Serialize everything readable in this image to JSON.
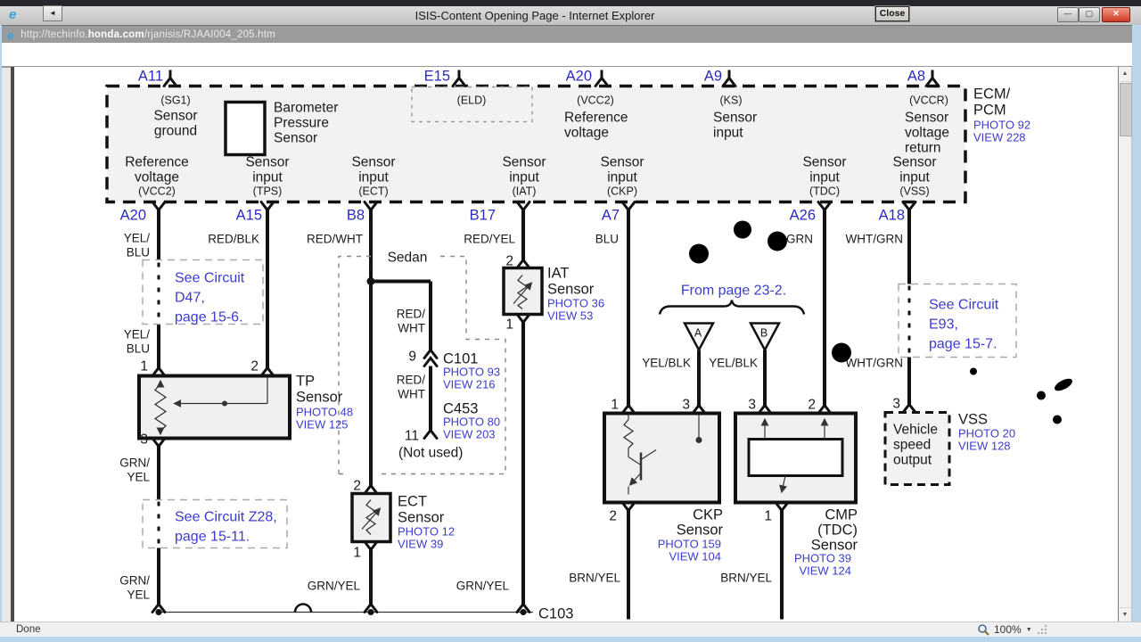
{
  "chrome": {
    "title": "ISIS-Content Opening Page - Internet Explorer",
    "logo": "e",
    "url": {
      "prefix": "http://techinfo.",
      "domain": "honda.com",
      "path": "/rjanisis/RJAAI004_205.htm"
    },
    "buttons": {
      "minimize": "—",
      "maximize": "▢",
      "close": "✕"
    },
    "back_arrow": "◄",
    "close_label": "Close",
    "scroll_up": "▲",
    "scroll_down": "▼",
    "status": "Done",
    "zoom_level": "100%",
    "zoom_caret": "▼"
  },
  "diagram": {
    "ecm": {
      "top_pins": [
        {
          "id": "A11",
          "sub": "(SG1)",
          "l1": "Sensor",
          "l2": "ground",
          "l3": ""
        },
        {
          "id": "E15",
          "sub": "(ELD)",
          "l1": "",
          "l2": "",
          "l3": ""
        },
        {
          "id": "A20",
          "sub": "(VCC2)",
          "l1": "Reference",
          "l2": "voltage",
          "l3": ""
        },
        {
          "id": "A9",
          "sub": "(KS)",
          "l1": "Sensor",
          "l2": "input",
          "l3": ""
        },
        {
          "id": "A8",
          "sub": "(VCCR)",
          "l1": "Sensor",
          "l2": "voltage",
          "l3": "return"
        }
      ],
      "baro": {
        "l1": "Barometer",
        "l2": "Pressure",
        "l3": "Sensor"
      },
      "bottom_labels": [
        {
          "l1": "Reference",
          "l2": "voltage",
          "sub": "(VCC2)"
        },
        {
          "l1": "Sensor",
          "l2": "input",
          "sub": "(TPS)"
        },
        {
          "l1": "Sensor",
          "l2": "input",
          "sub": "(ECT)"
        },
        {
          "l1": "Sensor",
          "l2": "input",
          "sub": "(IAT)"
        },
        {
          "l1": "Sensor",
          "l2": "input",
          "sub": "(CKP)"
        },
        {
          "l1": "Sensor",
          "l2": "input",
          "sub": "(TDC)"
        },
        {
          "l1": "Sensor",
          "l2": "input",
          "sub": "(VSS)"
        }
      ],
      "name1": "ECM/",
      "name2": "PCM",
      "photo": "PHOTO 92",
      "view": "VIEW 228"
    },
    "pins": {
      "p1": "A20",
      "p2": "A15",
      "p3": "B8",
      "p4": "B17",
      "p5": "A7",
      "p6": "A26",
      "p7": "A18"
    },
    "wires": {
      "yel_blu1a": "YEL/",
      "yel_blu1b": "BLU",
      "red_blk": "RED/BLK",
      "red_wht": "RED/WHT",
      "red_yel": "RED/YEL",
      "blu": "BLU",
      "grn": "GRN",
      "wht_grn": "WHT/GRN",
      "yel_blu2a": "YEL/",
      "yel_blu2b": "BLU",
      "red_wht2a": "RED/",
      "red_wht2b": "WHT",
      "red_wht3a": "RED/",
      "red_wht3b": "WHT",
      "yel_blk1": "YEL/BLK",
      "yel_blk2": "YEL/BLK",
      "wht_grn2": "WHT/GRN",
      "grn_yel1a": "GRN/",
      "grn_yel1b": "YEL",
      "grn_yel2a": "GRN/",
      "grn_yel2b": "YEL",
      "grn_yel3": "GRN/YEL",
      "grn_yel4": "GRN/YEL",
      "brn_yel1": "BRN/YEL",
      "brn_yel2": "BRN/YEL"
    },
    "refs": {
      "d47_1": "See Circuit",
      "d47_2": "D47,",
      "d47_3": "page 15-6.",
      "z28_1": "See Circuit Z28,",
      "z28_2": "page 15-11.",
      "e93_1": "See Circuit",
      "e93_2": "E93,",
      "e93_3": "page 15-7.",
      "from_page": "From page 23-2.",
      "tri_a": "A",
      "tri_b": "B"
    },
    "sensors": {
      "tp": {
        "n1": "TP",
        "n2": "Sensor",
        "photo": "PHOTO 48",
        "view": "VIEW 125",
        "pin_tl": "1",
        "pin_tr": "2",
        "pin_b": "3"
      },
      "iat": {
        "n1": "IAT",
        "n2": "Sensor",
        "photo": "PHOTO 36",
        "view": "VIEW 53",
        "pin_t": "2",
        "pin_b": "1"
      },
      "ect": {
        "n1": "ECT",
        "n2": "Sensor",
        "photo": "PHOTO 12",
        "view": "VIEW 39",
        "pin_t": "2",
        "pin_b": "1"
      },
      "ckp": {
        "n1": "CKP",
        "n2": "Sensor",
        "photo": "PHOTO 159",
        "view": "VIEW 104",
        "pin_tl": "1",
        "pin_tr": "3",
        "pin_b": "2"
      },
      "cmp": {
        "n1": "CMP",
        "n2": "(TDC)",
        "n3": "Sensor",
        "photo": "PHOTO 39",
        "view": "VIEW 124",
        "pin_tl": "3",
        "pin_tr": "2",
        "pin_b": "1"
      },
      "vss": {
        "label": "VSS",
        "photo": "PHOTO 20",
        "view": "VIEW 128",
        "b1": "Vehicle",
        "b2": "speed",
        "b3": "output",
        "pin_t": "3"
      }
    },
    "connectors": {
      "sedan": "Sedan",
      "c101": {
        "pin": "9",
        "name": "C101",
        "photo": "PHOTO 93",
        "view": "VIEW 216"
      },
      "c453": {
        "pin": "11",
        "name": "C453",
        "photo": "PHOTO 80",
        "view": "VIEW 203",
        "note": "(Not used)"
      },
      "c103": "C103"
    }
  }
}
